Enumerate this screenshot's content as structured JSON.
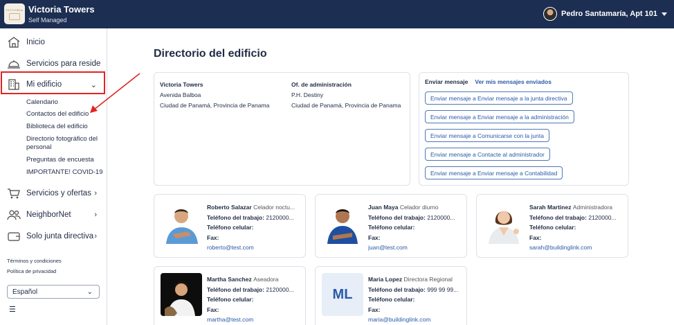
{
  "app": {
    "title": "Victoria Towers",
    "subtitle": "Self Managed",
    "logo_text": "VICTORIA"
  },
  "user": {
    "name": "Pedro Santamaría, Apt 101"
  },
  "sidebar": {
    "items": [
      {
        "label": "Inicio",
        "icon": "home-icon"
      },
      {
        "label": "Servicios para residentes",
        "icon": "service-bell-icon"
      },
      {
        "label": "Mi edificio",
        "icon": "building-icon"
      },
      {
        "label": "Servicios y ofertas",
        "icon": "cart-icon"
      },
      {
        "label": "NeighborNet",
        "icon": "people-icon"
      },
      {
        "label": "Solo junta directiva",
        "icon": "wallet-icon"
      }
    ],
    "submenu": [
      "Calendario",
      "Contactos del edificio",
      "Biblioteca del edificio",
      "Directorio fotográfico del personal",
      "Preguntas de encuesta",
      "IMPORTANTE! COVID-19"
    ],
    "footer_links": [
      "Términos y condiciones",
      "Política de privacidad"
    ],
    "language": "Español"
  },
  "main": {
    "title": "Directorio del edificio",
    "building": {
      "heading": "Victoria Towers",
      "line1": "Avenida Balboa",
      "line2": "Ciudad de Panamá, Provincia de Panama"
    },
    "admin_office": {
      "heading": "Of. de administración",
      "line1": "P.H. Destiny",
      "line2": "Ciudad de Panamá, Provincia de Panama"
    },
    "messages": {
      "heading": "Enviar mensaje",
      "sent_link": "Ver mis mensajes enviados",
      "buttons": [
        "Enviar mensaje a Enviar mensaje a la junta directiva",
        "Enviar mensaje a Enviar mensaje a la administración",
        "Enviar mensaje a Comunicarse con la junta",
        "Enviar mensaje a Contacte al administrador",
        "Enviar mensaje a Enviar mensaje a Contabilidad"
      ]
    },
    "contacts": [
      {
        "name": "Roberto Salazar",
        "role": "Celador noctu...",
        "work_phone_label": "Teléfono del trabajo:",
        "work_phone": "2120000...",
        "cell_label": "Teléfono celular:",
        "fax_label": "Fax:",
        "email": "roberto@test.com"
      },
      {
        "name": "Juan Maya",
        "role": "Celador diurno",
        "work_phone_label": "Teléfono del trabajo:",
        "work_phone": "2120000...",
        "cell_label": "Teléfono celular:",
        "fax_label": "Fax:",
        "email": "juan@test.com"
      },
      {
        "name": "Sarah Martinez",
        "role": "Administradora",
        "work_phone_label": "Teléfono del trabajo:",
        "work_phone": "2120000...",
        "cell_label": "Teléfono celular:",
        "fax_label": "Fax:",
        "email": "sarah@buildinglink.com"
      },
      {
        "name": "Martha Sanchez",
        "role": "Aseadora",
        "work_phone_label": "Teléfono del trabajo:",
        "work_phone": "2120000...",
        "cell_label": "Teléfono celular:",
        "fax_label": "Fax:",
        "email": "martha@test.com"
      },
      {
        "name": "Maria Lopez",
        "role": "Directora Regional",
        "work_phone_label": "Teléfono del trabajo:",
        "work_phone": "999 99 99...",
        "cell_label": "Teléfono celular:",
        "fax_label": "Fax:",
        "email": "maria@buildinglink.com",
        "initials": "ML"
      }
    ]
  },
  "colors": {
    "header": "#1c2e52",
    "link": "#2a5aa8",
    "annotation": "#e02424"
  }
}
